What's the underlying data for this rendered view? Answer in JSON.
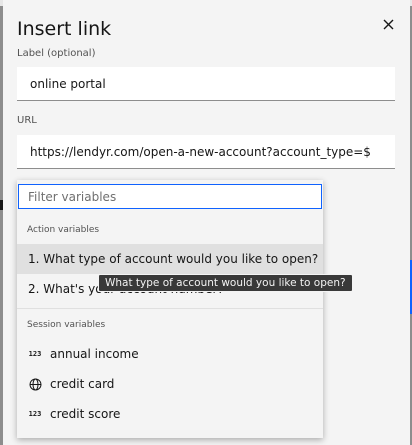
{
  "modal": {
    "title": "Insert link",
    "label_field": {
      "label": "Label (optional)",
      "value": "online portal"
    },
    "url_field": {
      "label": "URL",
      "value": "https://lendyr.com/open-a-new-account?account_type=$"
    }
  },
  "dropdown": {
    "filter_placeholder": "Filter variables",
    "action_section_label": "Action variables",
    "action_items": [
      {
        "label": "1. What type of account would you like to open?"
      },
      {
        "label": "2. What's your account number?"
      }
    ],
    "session_section_label": "Session variables",
    "session_items": [
      {
        "label": "annual income",
        "icon": "number-icon",
        "icon_text": "123"
      },
      {
        "label": "credit card",
        "icon": "globe-icon"
      },
      {
        "label": "credit score",
        "icon": "number-icon",
        "icon_text": "123"
      }
    ]
  },
  "tooltip": {
    "text": "What type of account would you like to open?"
  },
  "colors": {
    "accent": "#0f62fe",
    "surface": "#f4f4f4",
    "field": "#ffffff",
    "tooltip_bg": "#393939"
  }
}
